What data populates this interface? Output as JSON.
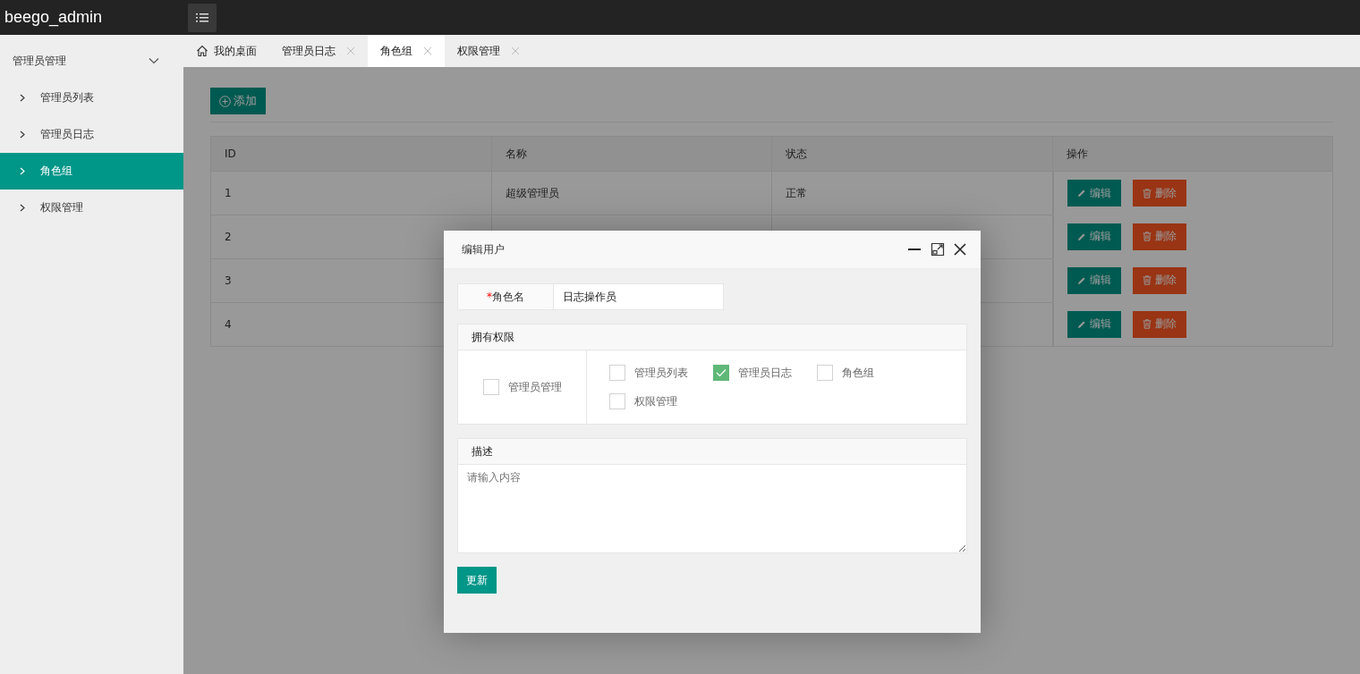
{
  "header": {
    "logo": "beego_admin"
  },
  "sidebar": {
    "group": {
      "label": "管理员管理",
      "expanded": true
    },
    "items": [
      {
        "label": "管理员列表",
        "selected": false
      },
      {
        "label": "管理员日志",
        "selected": false
      },
      {
        "label": "角色组",
        "selected": true
      },
      {
        "label": "权限管理",
        "selected": false
      }
    ]
  },
  "tabs": [
    {
      "label": "我的桌面",
      "kind": "home",
      "selected": false
    },
    {
      "label": "管理员日志",
      "kind": "closable",
      "selected": false
    },
    {
      "label": "角色组",
      "kind": "closable",
      "selected": true
    },
    {
      "label": "权限管理",
      "kind": "closable",
      "selected": false
    }
  ],
  "toolbar": {
    "add_button": "添加"
  },
  "table": {
    "columns": [
      "ID",
      "名称",
      "状态",
      "操作"
    ],
    "rows": [
      {
        "id": "1",
        "name": "超级管理员",
        "status": "正常",
        "edit": "编辑",
        "delete": "删除"
      },
      {
        "id": "2",
        "edit": "编辑",
        "delete": "删除"
      },
      {
        "id": "3",
        "edit": "编辑",
        "delete": "删除"
      },
      {
        "id": "4",
        "edit": "编辑",
        "delete": "删除"
      }
    ]
  },
  "dialog": {
    "title": "编辑用户",
    "name_label": "角色名",
    "name_required_mark": "*",
    "name_value": "日志操作员",
    "permissions_title": "拥有权限",
    "parent": {
      "label": "管理员管理",
      "checked": false
    },
    "children": [
      {
        "label": "管理员列表",
        "checked": false
      },
      {
        "label": "管理员日志",
        "checked": true
      },
      {
        "label": "角色组",
        "checked": false
      },
      {
        "label": "权限管理",
        "checked": false
      }
    ],
    "description_title": "描述",
    "description_placeholder": "请输入内容",
    "submit": "更新"
  }
}
